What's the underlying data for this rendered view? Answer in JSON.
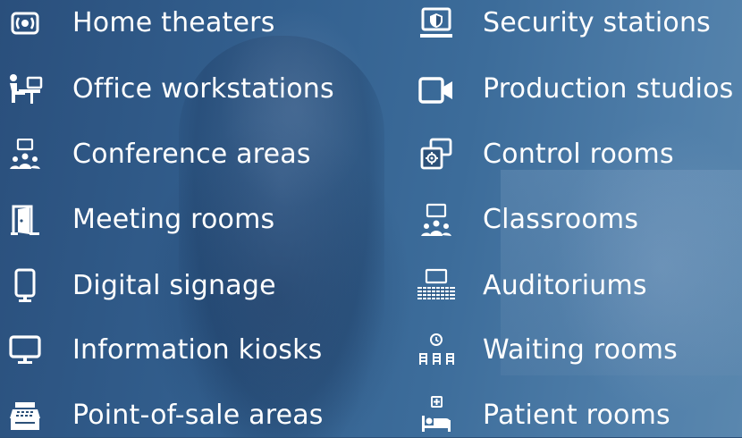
{
  "left_column": [
    {
      "label": "Home theaters",
      "icon": "home-theater-icon"
    },
    {
      "label": "Office workstations",
      "icon": "office-workstation-icon"
    },
    {
      "label": "Conference areas",
      "icon": "conference-area-icon"
    },
    {
      "label": "Meeting rooms",
      "icon": "meeting-room-door-icon"
    },
    {
      "label": "Digital signage",
      "icon": "digital-signage-icon"
    },
    {
      "label": "Information kiosks",
      "icon": "information-kiosk-icon"
    },
    {
      "label": "Point-of-sale areas",
      "icon": "point-of-sale-icon"
    }
  ],
  "right_column": [
    {
      "label": "Security stations",
      "icon": "security-station-icon"
    },
    {
      "label": "Production studios",
      "icon": "video-camera-icon"
    },
    {
      "label": "Control rooms",
      "icon": "control-room-icon"
    },
    {
      "label": "Classrooms",
      "icon": "classroom-icon"
    },
    {
      "label": "Auditoriums",
      "icon": "auditorium-icon"
    },
    {
      "label": "Waiting rooms",
      "icon": "waiting-room-icon"
    },
    {
      "label": "Patient rooms",
      "icon": "patient-room-icon"
    }
  ],
  "colors": {
    "text": "#ffffff",
    "background": "#2c5078"
  }
}
